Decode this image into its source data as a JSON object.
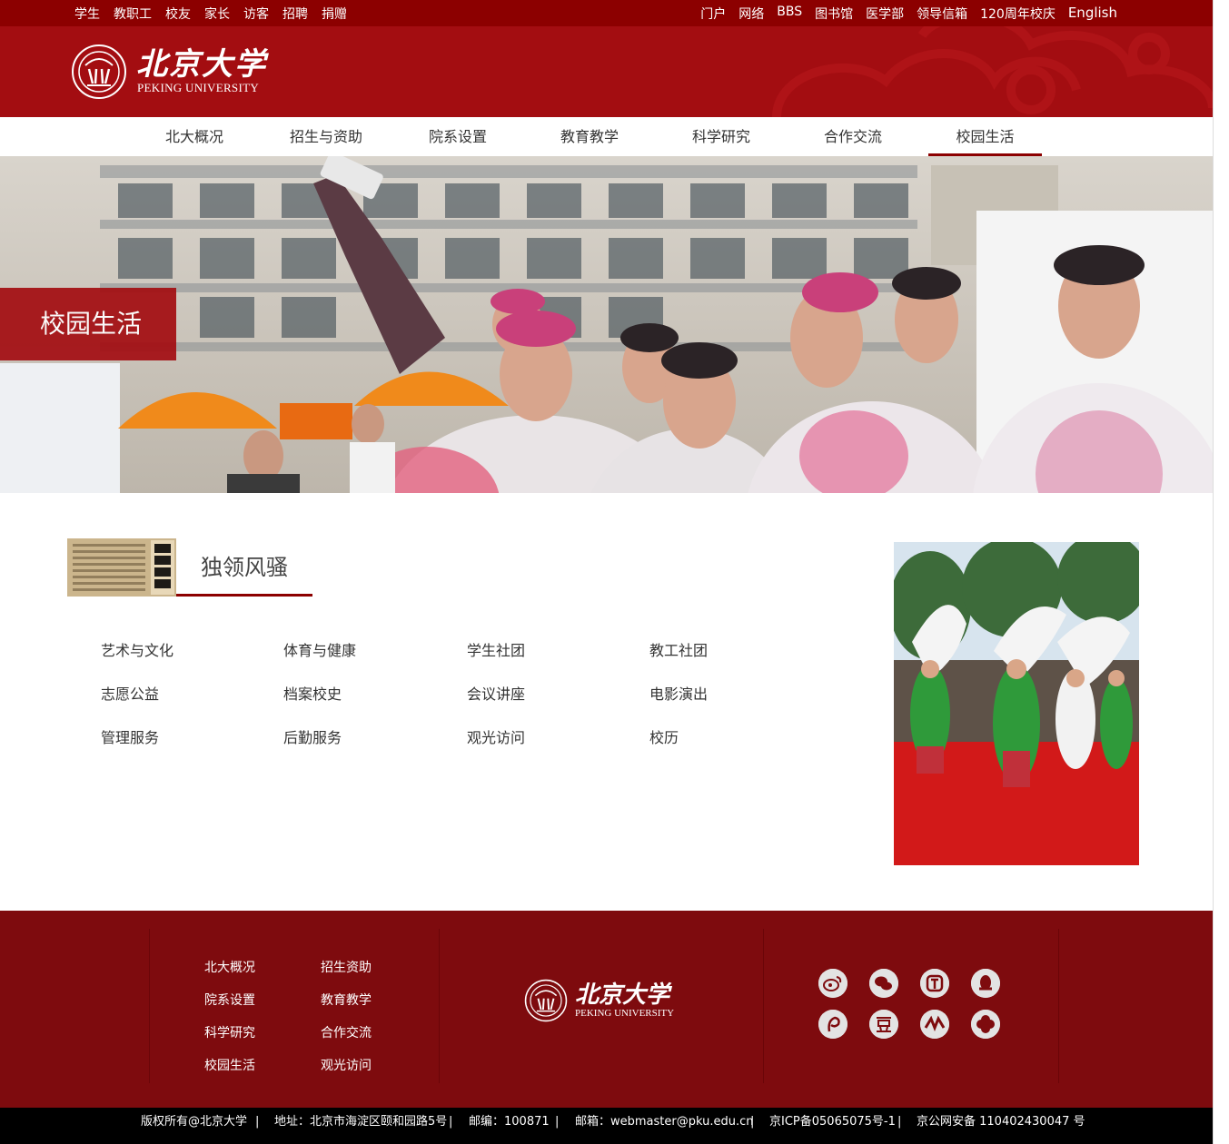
{
  "topbar": {
    "left_links": [
      "学生",
      "教职工",
      "校友",
      "家长",
      "访客",
      "招聘",
      "捐赠"
    ],
    "right_links": [
      "门户",
      "网络",
      "BBS",
      "图书馆",
      "医学部",
      "领导信箱",
      "120周年校庆",
      "English"
    ]
  },
  "header": {
    "logo_cn": "北京大学",
    "logo_en": "PEKING UNIVERSITY"
  },
  "nav": {
    "items": [
      "北大概况",
      "招生与资助",
      "院系设置",
      "教育教学",
      "科学研究",
      "合作交流",
      "校园生活"
    ],
    "active": "校园生活"
  },
  "banner": {
    "label": "校园生活"
  },
  "section": {
    "title": "独领风骚",
    "links": [
      [
        "艺术与文化",
        "体育与健康",
        "学生社团",
        "教工社团"
      ],
      [
        "志愿公益",
        "档案校史",
        "会议讲座",
        "电影演出"
      ],
      [
        "管理服务",
        "后勤服务",
        "观光访问",
        "校历"
      ]
    ]
  },
  "footer": {
    "links_col1": [
      "北大概况",
      "院系设置",
      "科学研究",
      "校园生活"
    ],
    "links_col2": [
      "招生资助",
      "教育教学",
      "合作交流",
      "观光访问"
    ],
    "logo_cn": "北京大学",
    "logo_en": "PEKING UNIVERSITY",
    "social_icons": [
      "weibo-icon",
      "wechat-icon",
      "tencent-weibo-icon",
      "qq-icon",
      "renren-icon",
      "douban-icon",
      "youku-icon",
      "clover-icon"
    ]
  },
  "bottombar": {
    "items": [
      "版权所有@北京大学",
      "|",
      "地址：北京市海淀区颐和园路5号",
      "|",
      "邮编：100871",
      "|",
      "邮箱：webmaster@pku.edu.cn",
      "|",
      "京ICP备05065075号-1",
      "|",
      "京公网安备 110402430047 号"
    ]
  },
  "colors": {
    "brand_red": "#a30d11",
    "topbar_red": "#8c0000",
    "footer_red": "#7e0b0e"
  }
}
